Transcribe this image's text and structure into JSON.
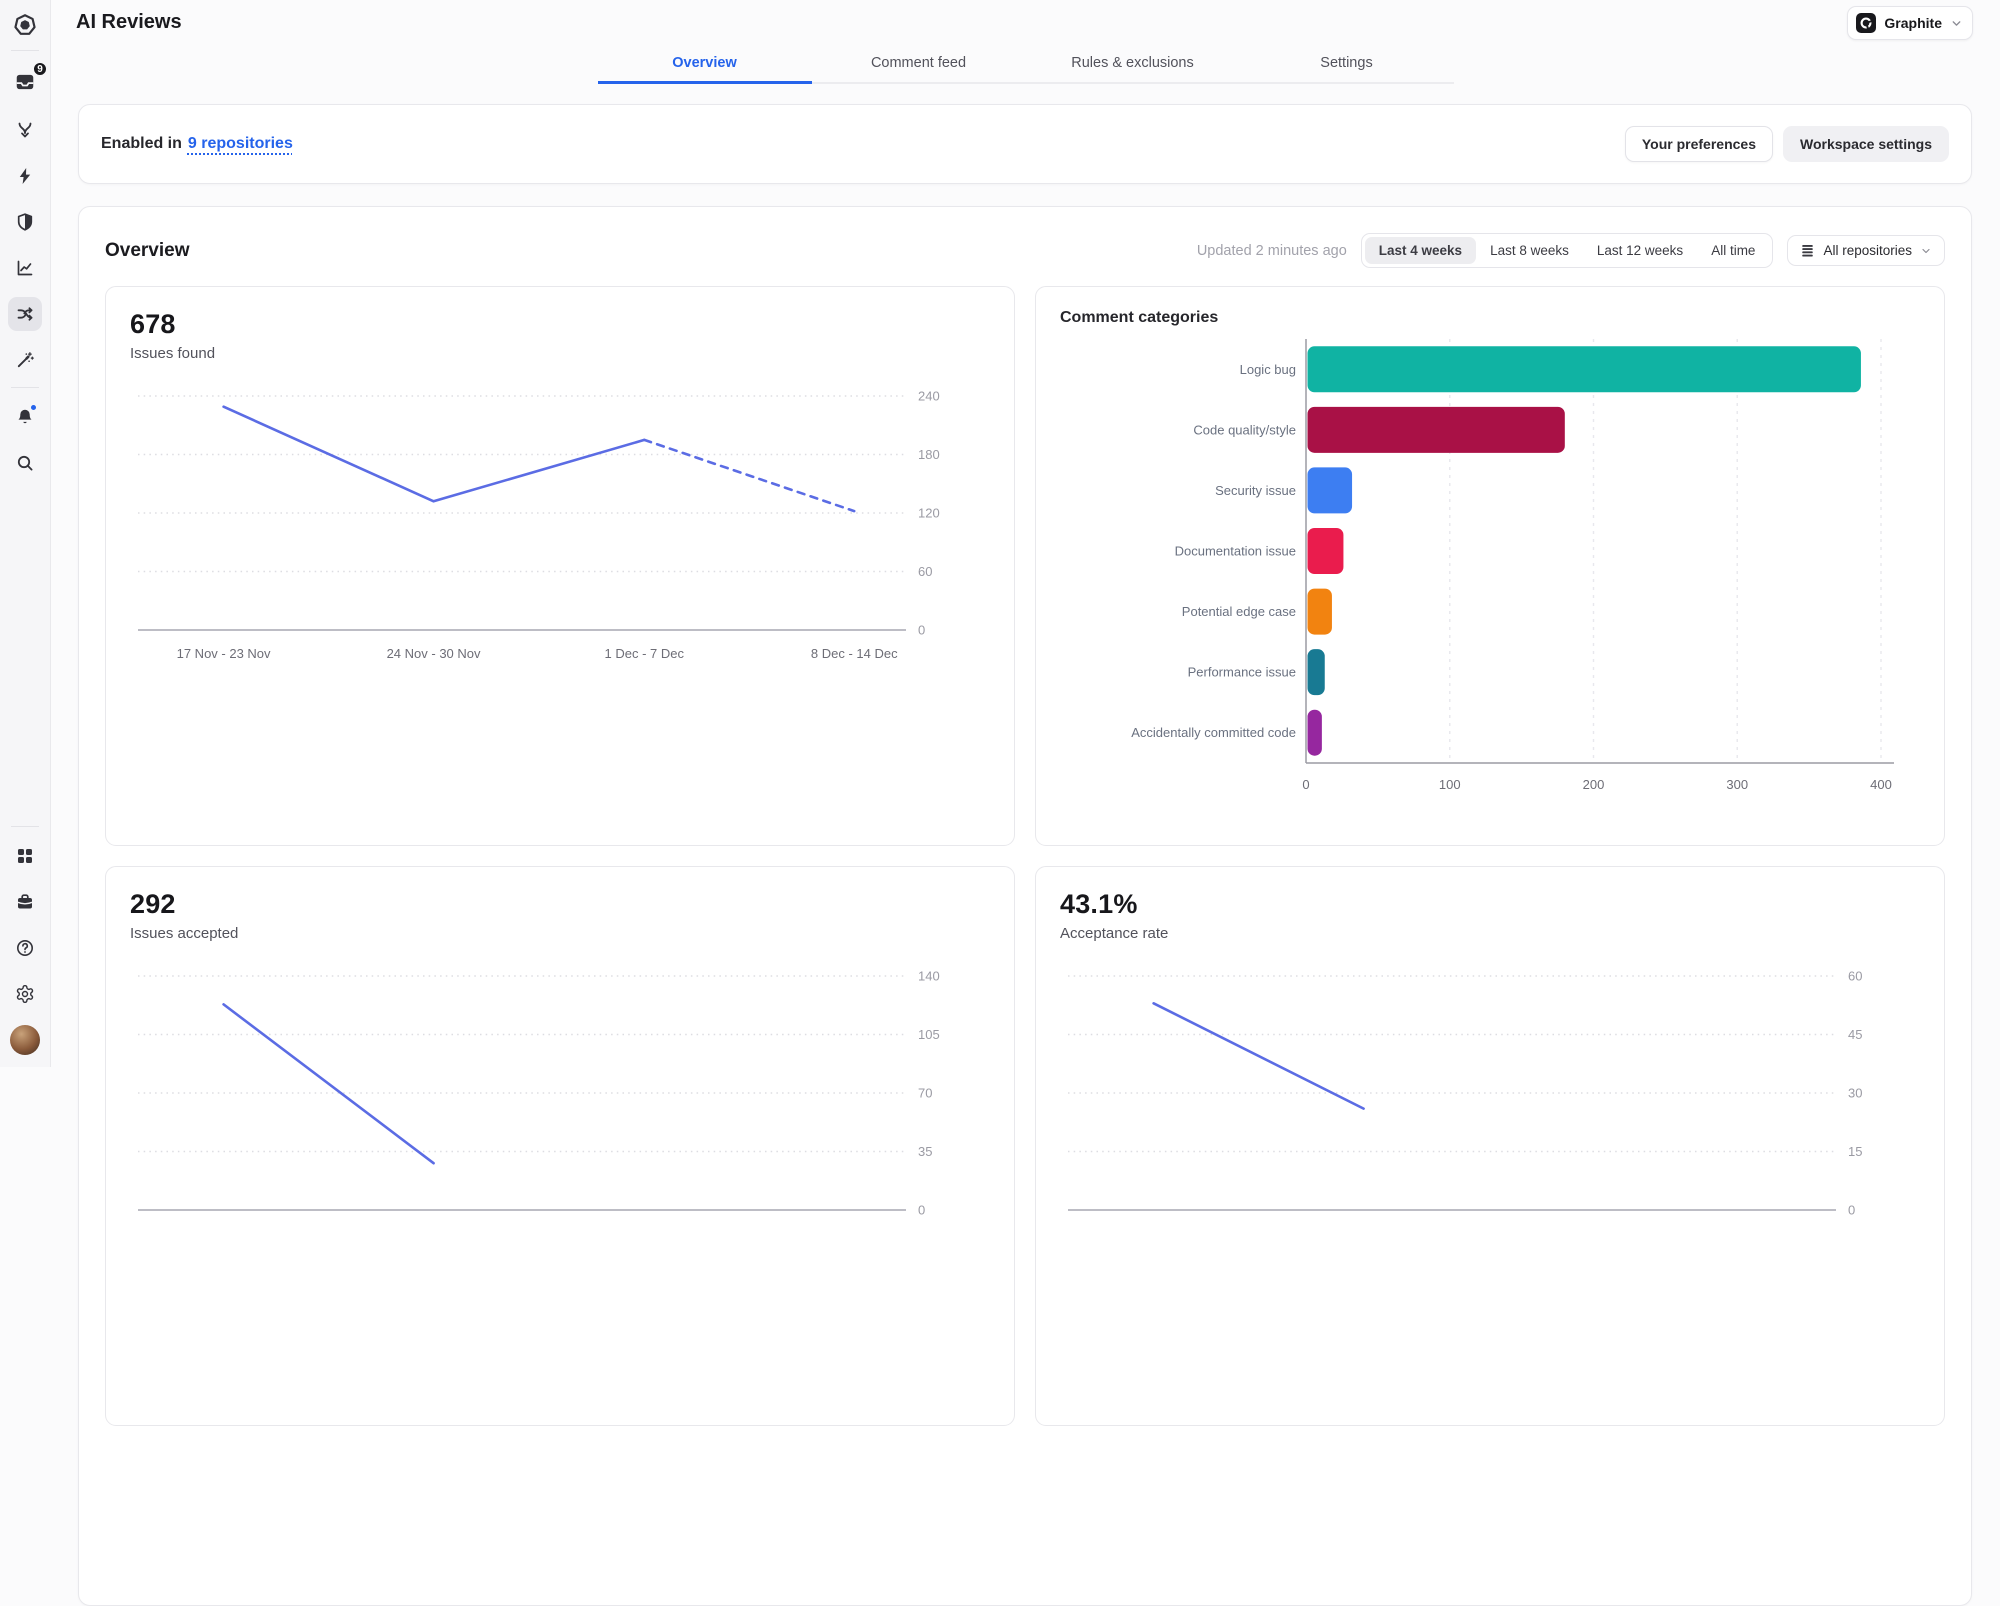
{
  "header": {
    "title": "AI Reviews",
    "workspace_button": {
      "label": "Graphite"
    }
  },
  "sidebar": {
    "inbox_badge": "9"
  },
  "tabs": [
    {
      "label": "Overview",
      "active": true
    },
    {
      "label": "Comment feed",
      "active": false
    },
    {
      "label": "Rules & exclusions",
      "active": false
    },
    {
      "label": "Settings",
      "active": false
    }
  ],
  "banner": {
    "prefix": "Enabled in",
    "link_label": "9 repositories",
    "preferences_button": "Your preferences",
    "workspace_settings_button": "Workspace settings"
  },
  "overview": {
    "title": "Overview",
    "updated_text": "Updated 2 minutes ago",
    "time_filters": {
      "options": [
        "Last 4 weeks",
        "Last 8 weeks",
        "Last 12 weeks",
        "All time"
      ],
      "selected": "Last 4 weeks"
    },
    "repo_filter_label": "All repositories"
  },
  "colors": {
    "accent_blue": "#2563eb",
    "line_blue": "#5b6ce4"
  },
  "chart_data": [
    {
      "name": "issues-found",
      "type": "line",
      "big_number": "678",
      "subtitle": "Issues found",
      "x_labels": [
        "17 Nov - 23 Nov",
        "24 Nov - 30 Nov",
        "1 Dec - 7 Dec",
        "8 Dec - 14 Dec"
      ],
      "values": [
        229,
        132,
        195,
        122
      ],
      "ymax": 240,
      "yticks": [
        240,
        180,
        120,
        60,
        0
      ],
      "dashed_from": 2,
      "line_color": "#5b6ce4"
    },
    {
      "name": "comment-categories",
      "type": "bar",
      "title": "Comment categories",
      "categories": [
        "Logic bug",
        "Code quality/style",
        "Security issue",
        "Documentation issue",
        "Potential edge case",
        "Performance issue",
        "Accidentally committed code"
      ],
      "values": [
        385,
        179,
        31,
        25,
        17,
        12,
        10
      ],
      "colors": [
        "#10b3a3",
        "#a91146",
        "#3d7ef2",
        "#ea1c4d",
        "#f28310",
        "#187a93",
        "#96279f"
      ],
      "xmax": 400,
      "xticks": [
        0,
        100,
        200,
        300,
        400
      ]
    },
    {
      "name": "issues-accepted",
      "type": "line",
      "big_number": "292",
      "subtitle": "Issues accepted",
      "values": [
        123,
        28
      ],
      "ymax": 140,
      "yticks": [
        140,
        105,
        70,
        35,
        0
      ],
      "line_color": "#5b6ce4"
    },
    {
      "name": "acceptance-rate",
      "type": "line",
      "big_number": "43.1%",
      "subtitle": "Acceptance rate",
      "values": [
        53,
        26
      ],
      "ymax": 60,
      "yticks": [
        60,
        45,
        30,
        15,
        0
      ],
      "line_color": "#5b6ce4"
    }
  ]
}
